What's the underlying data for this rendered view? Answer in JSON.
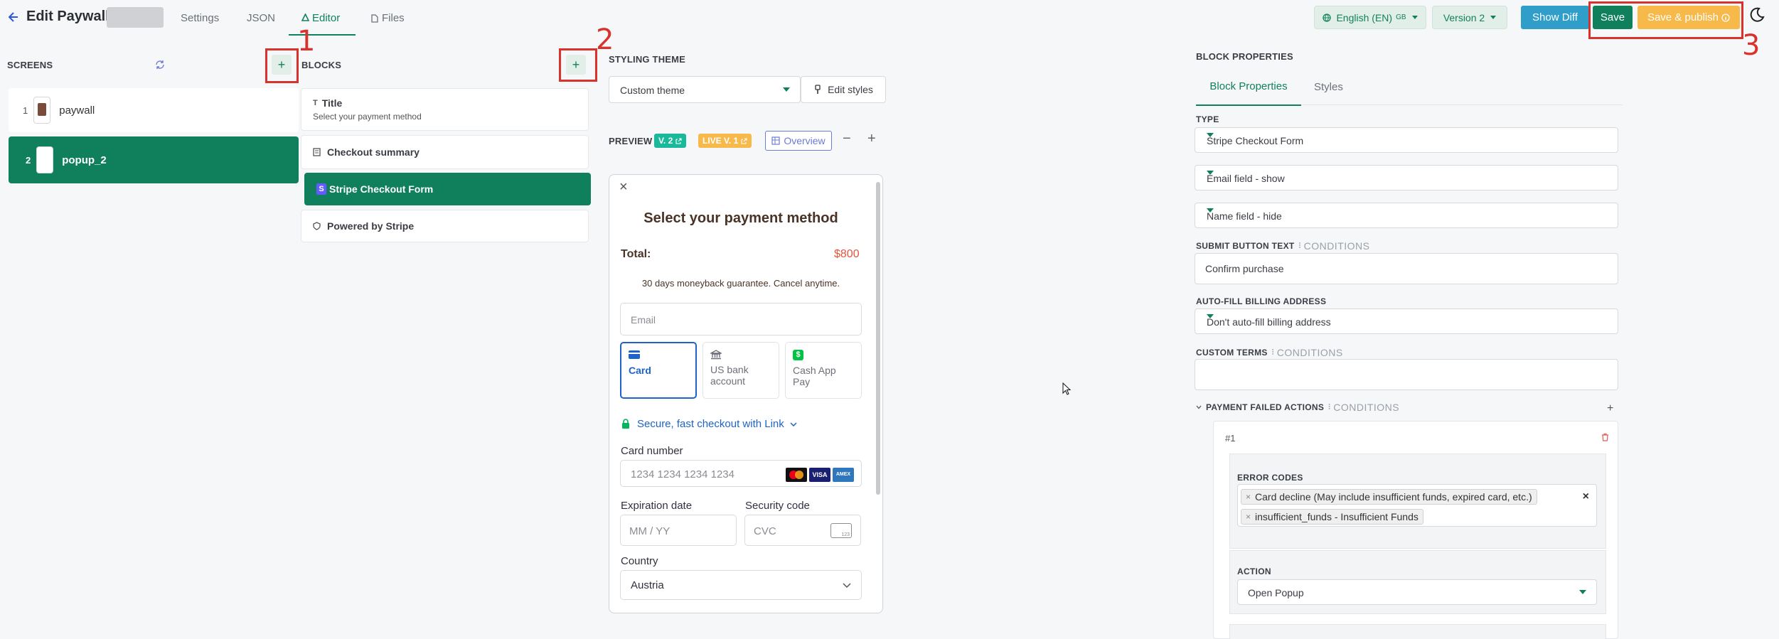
{
  "header": {
    "back_icon": "arrow-left-icon",
    "title": "Edit Paywall:",
    "tabs": [
      {
        "label": "Settings"
      },
      {
        "label": "JSON"
      },
      {
        "label": "Editor",
        "active": true
      },
      {
        "label": "Files"
      }
    ],
    "language": "English (EN)",
    "language_badge": "GB",
    "version": "Version 2",
    "show_diff": "Show Diff",
    "save": "Save",
    "save_publish": "Save & publish",
    "theme_icon": "moon-icon"
  },
  "annotations": [
    "1",
    "2",
    "3"
  ],
  "screens": {
    "label": "SCREENS",
    "add": "+",
    "items": [
      {
        "index": "1",
        "name": "paywall",
        "selected": false
      },
      {
        "index": "2",
        "name": "popup_2",
        "selected": true
      }
    ]
  },
  "blocks": {
    "label": "BLOCKS",
    "add": "+",
    "items": [
      {
        "title": "Title",
        "subtitle": "Select your payment method",
        "icon": "text-icon"
      },
      {
        "title": "Checkout summary",
        "icon": "receipt-icon"
      },
      {
        "title": "Stripe Checkout Form",
        "icon": "stripe-icon",
        "selected": true
      },
      {
        "title": "Powered by Stripe",
        "icon": "shield-icon"
      }
    ]
  },
  "styling": {
    "label": "STYLING THEME",
    "theme": "Custom theme",
    "edit_styles": "Edit styles"
  },
  "preview": {
    "label": "PREVIEW",
    "version_badge": "V. 2",
    "live_badge": "LIVE V. 1",
    "overview": "Overview",
    "zoom_out": "−",
    "zoom_in": "+",
    "close": "×",
    "heading": "Select your payment method",
    "total_label": "Total:",
    "total_value": "$800",
    "guarantee": "30 days moneyback guarantee. Cancel anytime.",
    "email_placeholder": "Email",
    "methods": [
      {
        "label": "Card",
        "icon": "card-icon",
        "selected": true
      },
      {
        "label": "US bank account",
        "icon": "bank-icon"
      },
      {
        "label": "Cash App Pay",
        "icon": "cash-app-icon"
      }
    ],
    "link_text": "Secure, fast checkout with Link",
    "card_number_label": "Card number",
    "card_number_placeholder": "1234 1234 1234 1234",
    "expiration_label": "Expiration date",
    "expiration_placeholder": "MM / YY",
    "security_label": "Security code",
    "security_placeholder": "CVC",
    "country_label": "Country",
    "country_value": "Austria",
    "cvc_badge": "123",
    "brand_visa": "VISA",
    "brand_amex": "AMEX"
  },
  "properties": {
    "label": "BLOCK PROPERTIES",
    "tabs": [
      {
        "label": "Block Properties",
        "active": true
      },
      {
        "label": "Styles"
      }
    ],
    "type_label": "TYPE",
    "type_value": "Stripe Checkout Form",
    "email_field": "Email field - show",
    "name_field": "Name field - hide",
    "submit_label": "SUBMIT BUTTON TEXT",
    "conditions": "CONDITIONS",
    "submit_value": "Confirm purchase",
    "autofill_label": "AUTO-FILL BILLING ADDRESS",
    "autofill_value": "Don't auto-fill billing address",
    "terms_label": "CUSTOM TERMS",
    "failed_label": "PAYMENT FAILED ACTIONS",
    "add": "+",
    "action_number": "#1",
    "error_codes_label": "ERROR CODES",
    "error_codes": [
      "Card decline (May include insufficient funds, expired card, etc.)",
      "insufficient_funds - Insufficient Funds"
    ],
    "action_label": "ACTION",
    "action_value": "Open Popup",
    "chip_remove": "×",
    "clear": "×"
  },
  "colors": {
    "accent": "#10805c",
    "save_publish": "#f6b94a",
    "show_diff": "#2f9fc9",
    "annotation": "#d9322c",
    "total": "#e5533d"
  }
}
